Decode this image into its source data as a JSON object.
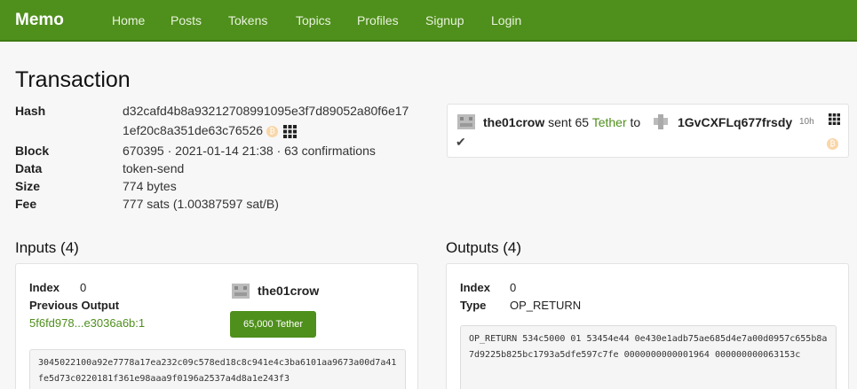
{
  "nav": {
    "brand": "Memo",
    "items": [
      "Home",
      "Posts",
      "Tokens",
      "Topics",
      "Profiles",
      "Signup",
      "Login"
    ]
  },
  "page": {
    "title": "Transaction"
  },
  "tx": {
    "hash_label": "Hash",
    "hash_line1": "d32cafd4b8a93212708991095e3f7d89052a80f6e17",
    "hash_line2": "1ef20c8a351de63c76526",
    "block_label": "Block",
    "block_value": "670395 · 2021-01-14 21:38 · 63 confirmations",
    "data_label": "Data",
    "data_value": "token-send",
    "size_label": "Size",
    "size_value": "774 bytes",
    "fee_label": "Fee",
    "fee_value": "777 sats (1.00387597 sat/B)"
  },
  "post": {
    "sender": "the01crow",
    "sent_text": "sent 65",
    "token": "Tether",
    "to_text": "to",
    "recipient": "1GvCXFLq677frsdy",
    "age": "10h",
    "check": "✔"
  },
  "inputs": {
    "title": "Inputs (4)",
    "index_label": "Index",
    "index_value": "0",
    "prev_output_label": "Previous Output",
    "prev_output_link": "5f6fd978...e3036a6b:1",
    "user": "the01crow",
    "token_button": "65,000 Tether",
    "script": "3045022100a92e7778a17ea232c09c578ed18c8c941e4c3ba6101aa9673a00d7a41fe5d73c0220181f361e98aaa9f0196a2537a4d8a1e243f3"
  },
  "outputs": {
    "title": "Outputs (4)",
    "index_label": "Index",
    "index_value": "0",
    "type_label": "Type",
    "type_value": "OP_RETURN",
    "script": "OP_RETURN 534c5000 01 53454e44 0e430e1adb75ae685d4e7a00d0957c655b8a7d9225b825bc1793a5dfe597c7fe 0000000000001964 000000000063153c"
  },
  "colors": {
    "brand_green": "#4f8f1c",
    "btc_orange": "#f9d6a8"
  }
}
